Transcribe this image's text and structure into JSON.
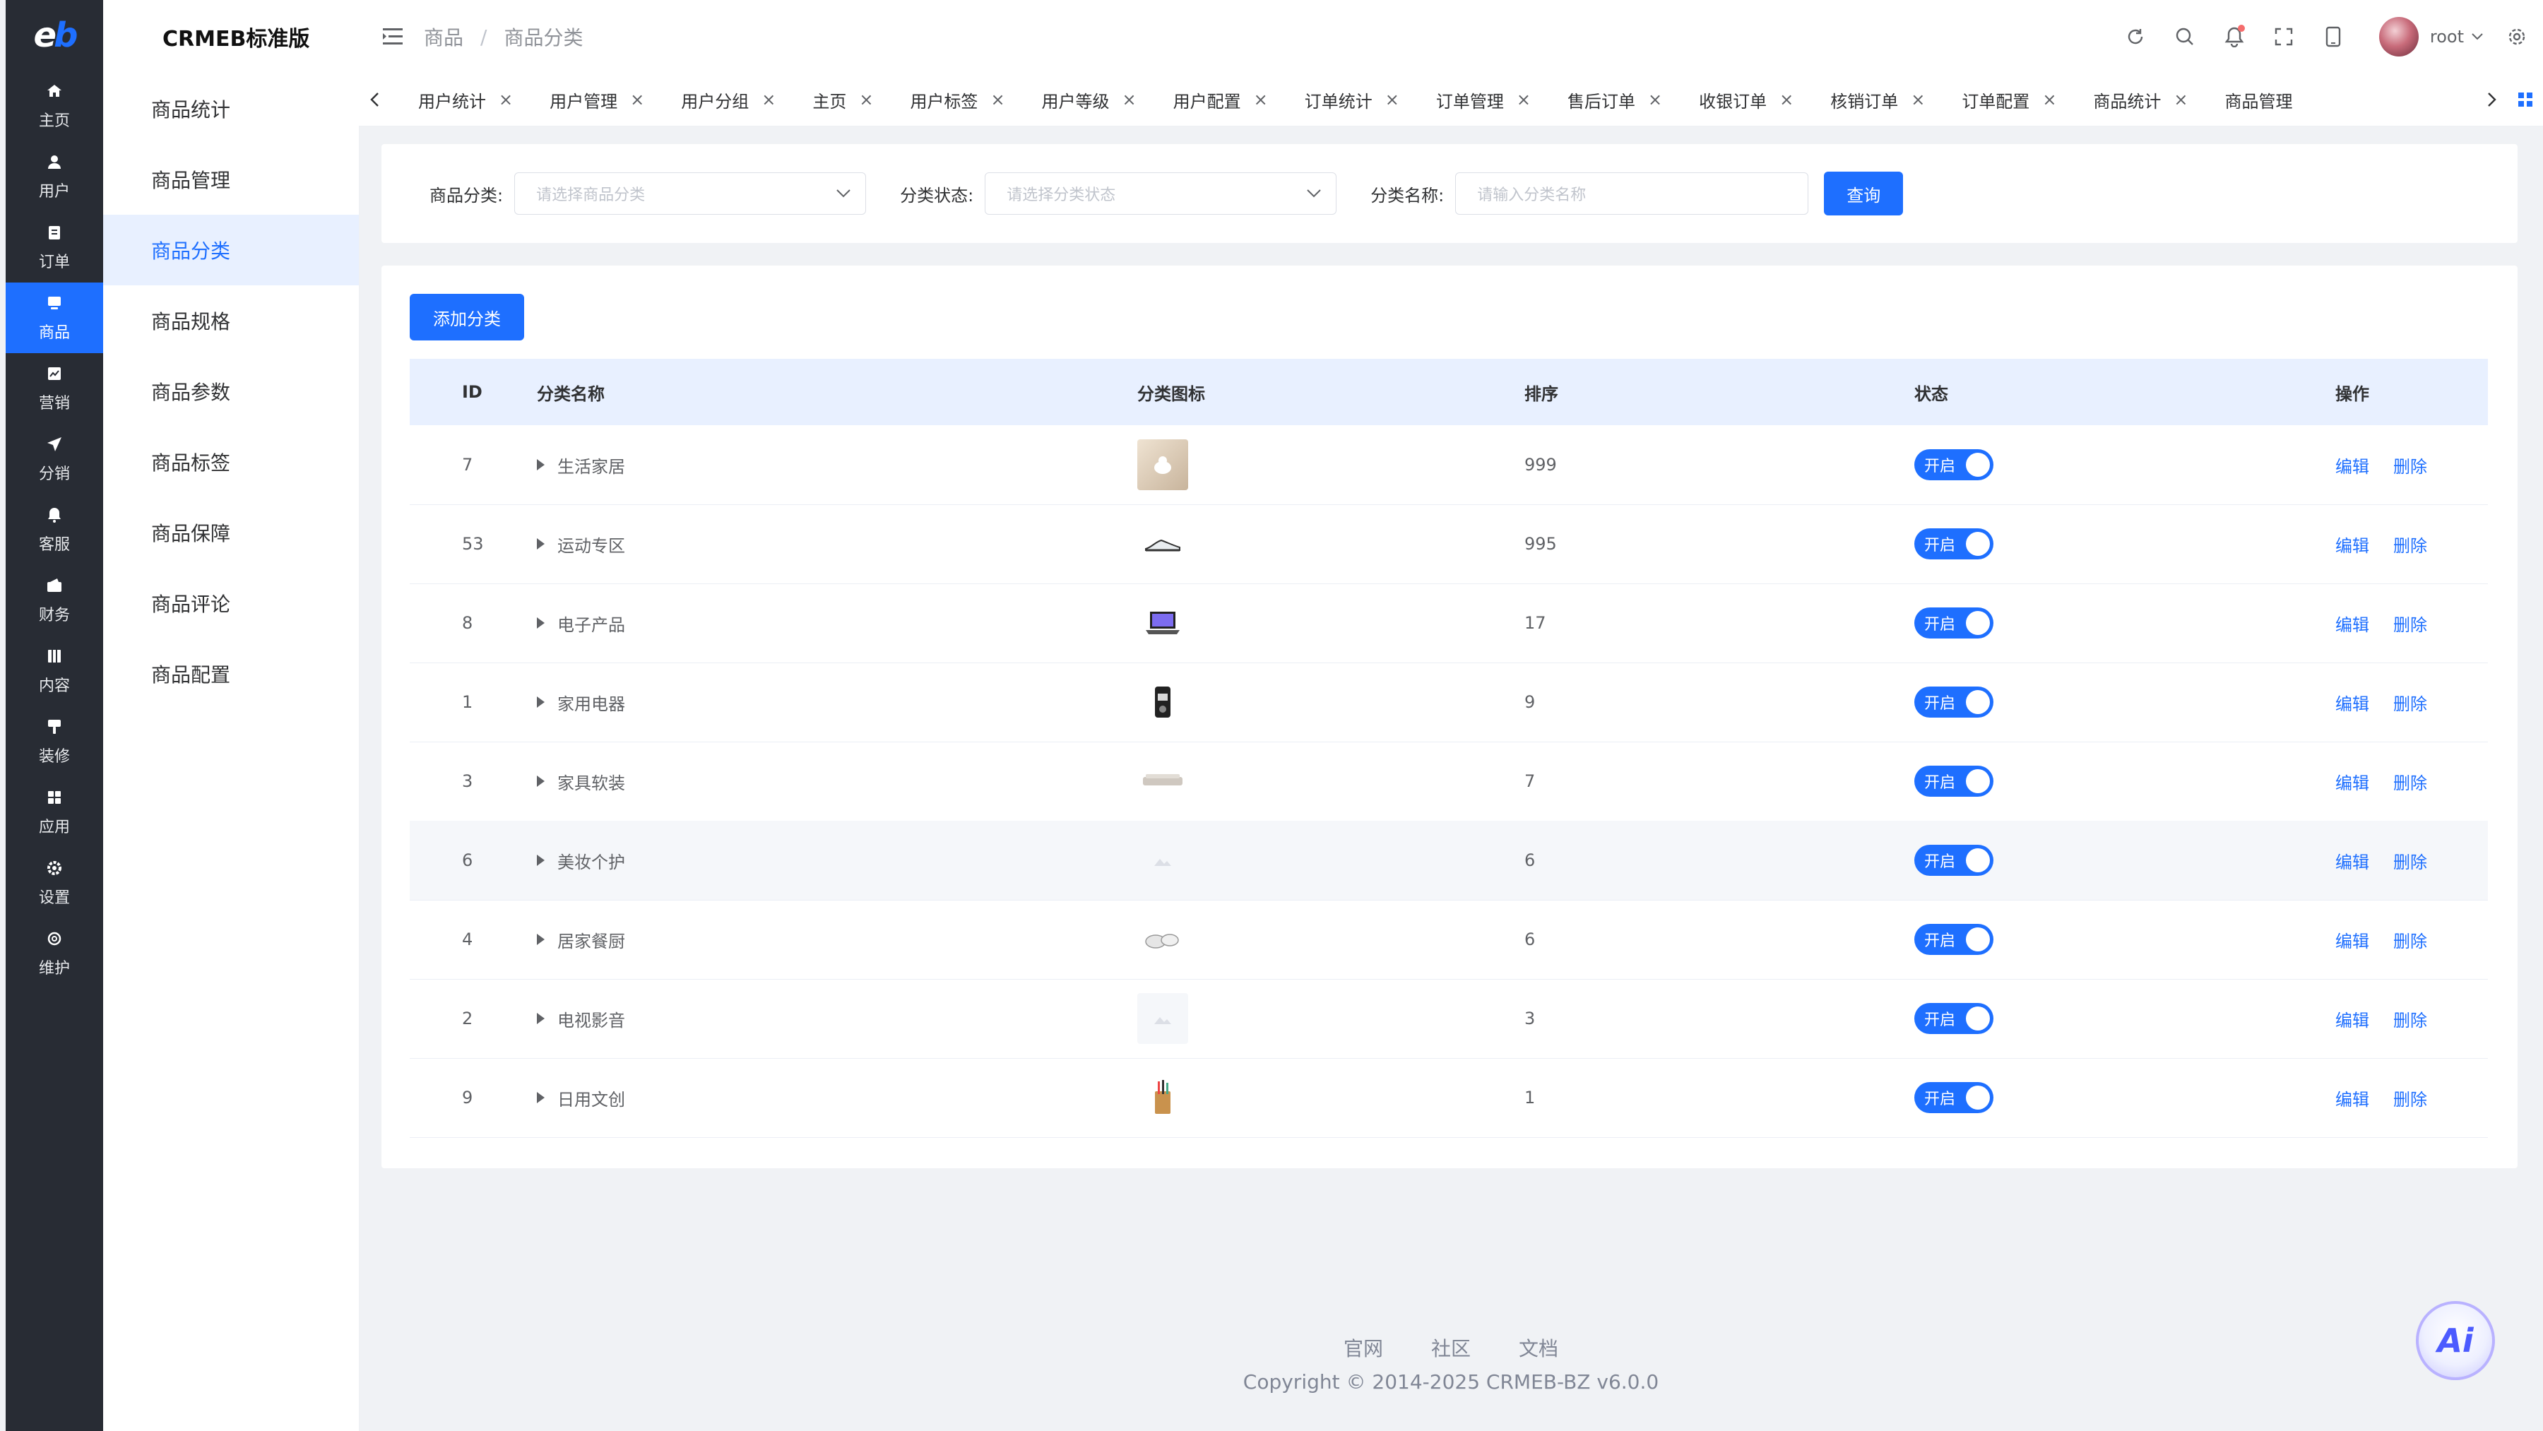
{
  "rail": {
    "logo_e": "e",
    "logo_b": "b",
    "items": [
      {
        "label": "主页",
        "icon": "home-icon"
      },
      {
        "label": "用户",
        "icon": "user-icon"
      },
      {
        "label": "订单",
        "icon": "order-icon"
      },
      {
        "label": "商品",
        "icon": "product-icon"
      },
      {
        "label": "营销",
        "icon": "marketing-icon"
      },
      {
        "label": "分销",
        "icon": "distribution-icon"
      },
      {
        "label": "客服",
        "icon": "service-icon"
      },
      {
        "label": "财务",
        "icon": "finance-icon"
      },
      {
        "label": "内容",
        "icon": "content-icon"
      },
      {
        "label": "装修",
        "icon": "decoration-icon"
      },
      {
        "label": "应用",
        "icon": "apps-icon"
      },
      {
        "label": "设置",
        "icon": "settings-icon"
      },
      {
        "label": "维护",
        "icon": "maintenance-icon"
      }
    ]
  },
  "submenu": {
    "brand": "CRMEB标准版",
    "items": [
      "商品统计",
      "商品管理",
      "商品分类",
      "商品规格",
      "商品参数",
      "商品标签",
      "商品保障",
      "商品评论",
      "商品配置"
    ]
  },
  "header": {
    "breadcrumb": [
      "商品",
      "商品分类"
    ],
    "separator": "/",
    "username": "root"
  },
  "tabs": [
    "用户统计",
    "用户管理",
    "用户分组",
    "主页",
    "用户标签",
    "用户等级",
    "用户配置",
    "订单统计",
    "订单管理",
    "售后订单",
    "收银订单",
    "核销订单",
    "订单配置",
    "商品统计",
    "商品管理"
  ],
  "tab_close": "×",
  "search": {
    "category_label": "商品分类:",
    "category_placeholder": "请选择商品分类",
    "status_label": "分类状态:",
    "status_placeholder": "请选择分类状态",
    "name_label": "分类名称:",
    "name_placeholder": "请输入分类名称",
    "search_button": "查询"
  },
  "table": {
    "add_button": "添加分类",
    "columns": [
      "ID",
      "分类名称",
      "分类图标",
      "排序",
      "状态",
      "操作"
    ],
    "switch_on_label": "开启",
    "edit_label": "编辑",
    "delete_label": "删除",
    "rows": [
      {
        "id": "7",
        "name": "生活家居",
        "sort": "999"
      },
      {
        "id": "53",
        "name": "运动专区",
        "sort": "995"
      },
      {
        "id": "8",
        "name": "电子产品",
        "sort": "17"
      },
      {
        "id": "1",
        "name": "家用电器",
        "sort": "9"
      },
      {
        "id": "3",
        "name": "家具软装",
        "sort": "7"
      },
      {
        "id": "6",
        "name": "美妆个护",
        "sort": "6"
      },
      {
        "id": "4",
        "name": "居家餐厨",
        "sort": "6"
      },
      {
        "id": "2",
        "name": "电视影音",
        "sort": "3"
      },
      {
        "id": "9",
        "name": "日用文创",
        "sort": "1"
      }
    ]
  },
  "footer": {
    "links": [
      "官网",
      "社区",
      "文档"
    ],
    "copyright": "Copyright © 2014-2025 CRMEB-BZ v6.0.0"
  },
  "ai_button": "Ai",
  "colors": {
    "primary": "#1e6fff",
    "rail_bg": "#282c34",
    "page_bg": "#f0f2f5"
  }
}
